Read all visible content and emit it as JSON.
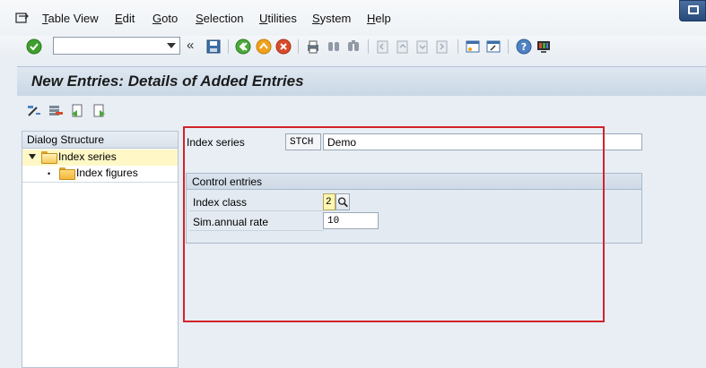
{
  "menu": [
    "Table View",
    "Edit",
    "Goto",
    "Selection",
    "Utilities",
    "System",
    "Help"
  ],
  "toolbar": {
    "command_value": "",
    "back_glyph": "«"
  },
  "title": "New Entries: Details of Added Entries",
  "dialog_structure": {
    "header": "Dialog Structure",
    "items": [
      {
        "label": "Index series",
        "selected": true,
        "expanded": true
      },
      {
        "label": "Index figures",
        "selected": false,
        "bullet": "•"
      }
    ]
  },
  "form": {
    "index_series_label": "Index series",
    "index_series_code": "STCH",
    "index_series_desc": "Demo",
    "group_title": "Control entries",
    "index_class_label": "Index class",
    "index_class_value": "2",
    "sim_rate_label": "Sim.annual rate",
    "sim_rate_value": "10"
  },
  "colors": {
    "highlight": "#d2232a",
    "selection": "#fff8c6",
    "title": "#1b1b1b"
  }
}
